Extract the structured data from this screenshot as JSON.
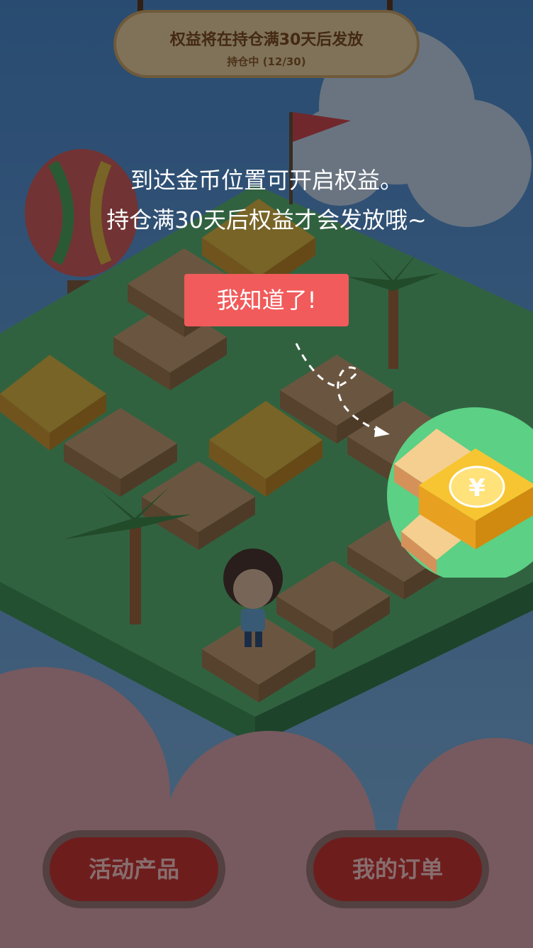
{
  "banner": {
    "title": "权益将在持仓满30天后发放",
    "progress_text": "持仓中 (12/30)",
    "progress": {
      "current": 12,
      "total": 30
    }
  },
  "tip": {
    "line1": "到达金币位置可开启权益。",
    "line2": "持仓满30天后权益才会发放哦~"
  },
  "ok_button_label": "我知道了!",
  "bottom_buttons": {
    "products": "活动产品",
    "orders": "我的订单"
  },
  "coin_symbol": "¥",
  "colors": {
    "accent": "#f15b5b",
    "highlight_ring": "#5cd084",
    "coin_gold": "#f7c531"
  }
}
